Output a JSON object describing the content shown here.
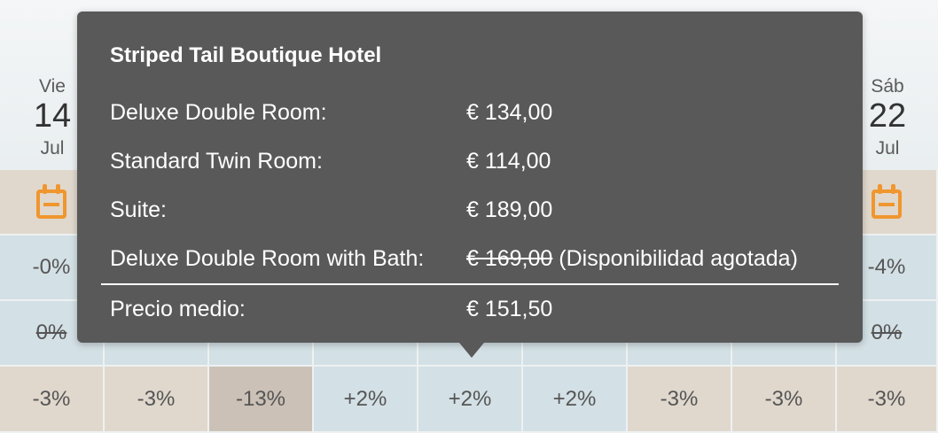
{
  "tooltip": {
    "title": "Striped Tail Boutique Hotel",
    "rooms": [
      {
        "name": "Deluxe Double Room:",
        "price": "€ 134,00"
      },
      {
        "name": "Standard Twin Room:",
        "price": "€ 114,00"
      },
      {
        "name": "Suite:",
        "price": "€ 189,00"
      },
      {
        "name": "Deluxe Double Room with Bath:",
        "price": "€ 169,00",
        "note": "(Disponibilidad agotada)"
      }
    ],
    "average_label": "Precio medio:",
    "average_price": "€ 151,50"
  },
  "calendar": {
    "left_day": {
      "weekday": "Vie",
      "day": "14",
      "month": "Jul",
      "row2": "-0%",
      "row3": "0%",
      "row4": "-3%"
    },
    "right_day": {
      "weekday": "Sáb",
      "day": "22",
      "month": "Jul",
      "row2": "-4%",
      "row3": "0%",
      "row4": "-3%"
    },
    "bottom_row": [
      "-3%",
      "-3%",
      "-13%",
      "+2%",
      "+2%",
      "+2%",
      "-3%",
      "-3%",
      "-3%"
    ]
  },
  "colors": {
    "tooltip_bg": "#595959",
    "calendar_icon": "#f0962e",
    "tan_cell": "#e0d8cd",
    "blue_cell": "#d3e0e5"
  }
}
